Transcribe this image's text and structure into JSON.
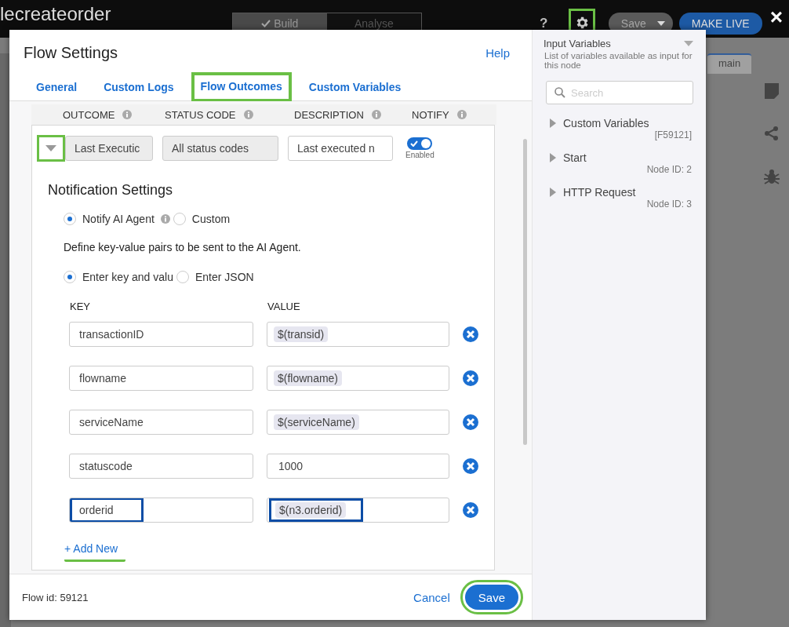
{
  "app_bar": {
    "title": "lecreateorder",
    "tabs": [
      {
        "label": "Build",
        "selected": true
      },
      {
        "label": "Analyse",
        "selected": false
      }
    ],
    "help": "?",
    "settings_highlighted": true,
    "save": "Save",
    "make_live": "MAKE LIVE",
    "close": "×"
  },
  "background": {
    "tab": "main"
  },
  "dialog": {
    "title": "Flow Settings",
    "help": "Help",
    "tabs": [
      {
        "label": "General",
        "selected": false,
        "highlighted": false
      },
      {
        "label": "Custom Logs",
        "selected": false,
        "highlighted": false
      },
      {
        "label": "Flow Outcomes",
        "selected": true,
        "highlighted": true
      },
      {
        "label": "Custom Variables",
        "selected": false,
        "highlighted": false
      }
    ],
    "columns": [
      {
        "label": "OUTCOME"
      },
      {
        "label": "STATUS CODE"
      },
      {
        "label": "DESCRIPTION"
      },
      {
        "label": "NOTIFY"
      }
    ],
    "outcome": {
      "expanded": true,
      "toggle_highlighted": true,
      "name": "Last Executic",
      "status": "All status codes",
      "description": "Last executed n",
      "notify_on": true,
      "notify_label": "Enabled"
    },
    "notification": {
      "title": "Notification Settings",
      "targets": [
        {
          "label": "Notify AI Agent",
          "selected": true,
          "info": true
        },
        {
          "label": "Custom",
          "selected": false,
          "info": false
        }
      ],
      "instructions": "Define key-value pairs to be sent to the AI Agent.",
      "modes": [
        {
          "label": "Enter key and valu",
          "selected": true
        },
        {
          "label": "Enter JSON",
          "selected": false
        }
      ],
      "key_header": "KEY",
      "value_header": "VALUE",
      "pairs": [
        {
          "key": "transactionID",
          "value": "$(transid)",
          "kind": "variable",
          "highlighted": false
        },
        {
          "key": "flowname",
          "value": "$(flowname)",
          "kind": "variable",
          "highlighted": false
        },
        {
          "key": "serviceName",
          "value": "$(serviceName)",
          "kind": "variable",
          "highlighted": false
        },
        {
          "key": "statuscode",
          "value": "1000",
          "kind": "literal",
          "highlighted": false
        },
        {
          "key": "orderid",
          "value": "$(n3.orderid)",
          "kind": "variable",
          "highlighted": true
        }
      ],
      "add_new": "+ Add New",
      "add_new_highlighted": true
    },
    "footer": {
      "flow_id": "Flow id: 59121",
      "cancel": "Cancel",
      "save": "Save",
      "save_highlighted": true
    }
  },
  "variables_panel": {
    "title": "Input Variables",
    "subtitle": "List of variables available as input for this node",
    "search_placeholder": "Search",
    "items": [
      {
        "label": "Custom Variables",
        "detail": "[F59121]",
        "expanded": false
      },
      {
        "label": "Start",
        "detail": "Node ID: 2",
        "expanded": false
      },
      {
        "label": "HTTP Request",
        "detail": "Node ID: 3",
        "expanded": false
      }
    ]
  }
}
